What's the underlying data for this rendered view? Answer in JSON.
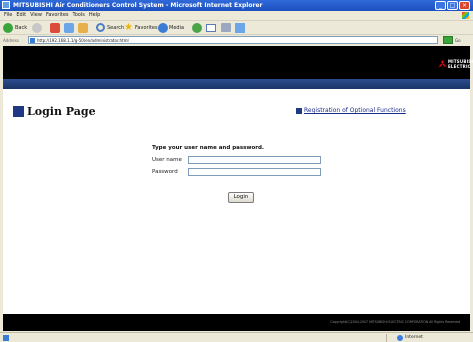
{
  "window": {
    "title": "MITSUBISHI Air Conditioners Control System - Microsoft Internet Explorer"
  },
  "menu": [
    "File",
    "Edit",
    "View",
    "Favorites",
    "Tools",
    "Help"
  ],
  "toolbar": {
    "back_label": "Back",
    "search_label": "Search",
    "favorites_label": "Favorites",
    "media_label": "Media"
  },
  "address": {
    "label": "Address",
    "url": "http://192.168.1.1/g-50/en/administrator.html",
    "go_label": "Go",
    "links_label": "Links"
  },
  "brand": {
    "name": "MITSUBISHI ELECTRIC"
  },
  "page": {
    "title": "Login Page",
    "reg_link": "Registration of Optional Functions",
    "instruction": "Type your user name and password.",
    "username_label": "User name",
    "password_label": "Password",
    "username_value": "",
    "password_value": "",
    "login_button": "Login",
    "copyright": "Copyright(C)2004-2007 MITSUBISHI ELECTRIC CORPORATION All Rights Reserved"
  },
  "status": {
    "zone": "Internet"
  }
}
